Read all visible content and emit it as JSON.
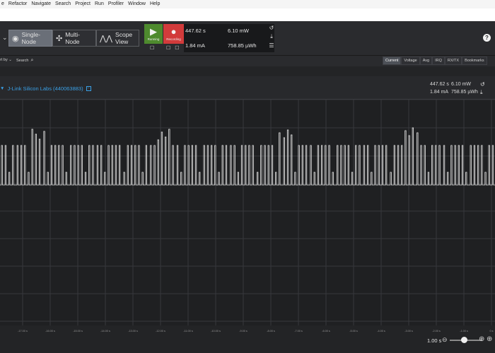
{
  "menubar": [
    "e",
    "Refactor",
    "Navigate",
    "Search",
    "Project",
    "Run",
    "Profiler",
    "Window",
    "Help"
  ],
  "toolbar": {
    "modes": [
      {
        "label": "Single-Node",
        "icon": "single-node-icon",
        "active": true
      },
      {
        "label": "Multi-Node",
        "icon": "multi-node-icon",
        "active": false
      },
      {
        "label": "Scope View",
        "icon": "scope-view-icon",
        "active": false
      }
    ],
    "run_label": "Running",
    "record_label": "Recording",
    "stats": {
      "time": "447.62 s",
      "power": "6.10 mW",
      "current": "1.84 mA",
      "energy": "758.85 µWh"
    }
  },
  "subbar": {
    "sort_label": "rt by",
    "search_label": "Search",
    "tabs": [
      "Current",
      "Voltage",
      "Avg",
      "IRQ",
      "RX/TX",
      "Bookmarks"
    ],
    "active_tab": "Current"
  },
  "channel": {
    "title": "J-Link Silicon Labs (440063883)",
    "time": "447.62 s",
    "power": "6.10 mW",
    "current": "1.84 mA",
    "energy": "758.85 µWh"
  },
  "axis": {
    "tick_labels": [
      "-17.00 s",
      "-16.00 s",
      "-15.00 s",
      "-14.00 s",
      "-13.00 s",
      "-12.00 s",
      "-11.00 s",
      "-10.00 s",
      "-9.00 s",
      "-8.00 s",
      "-7.00 s",
      "-6.00 s",
      "-5.00 s",
      "-4.00 s",
      "-3.00 s",
      "-2.00 s",
      "-1.00 s",
      "0 s"
    ]
  },
  "zoom": {
    "value": "1.00 s"
  },
  "colors": {
    "accent": "#3aa0e6",
    "running": "#4e8a2e",
    "recording": "#d23b3b",
    "trace": "#e8e8e8",
    "grid": "#37383c"
  }
}
